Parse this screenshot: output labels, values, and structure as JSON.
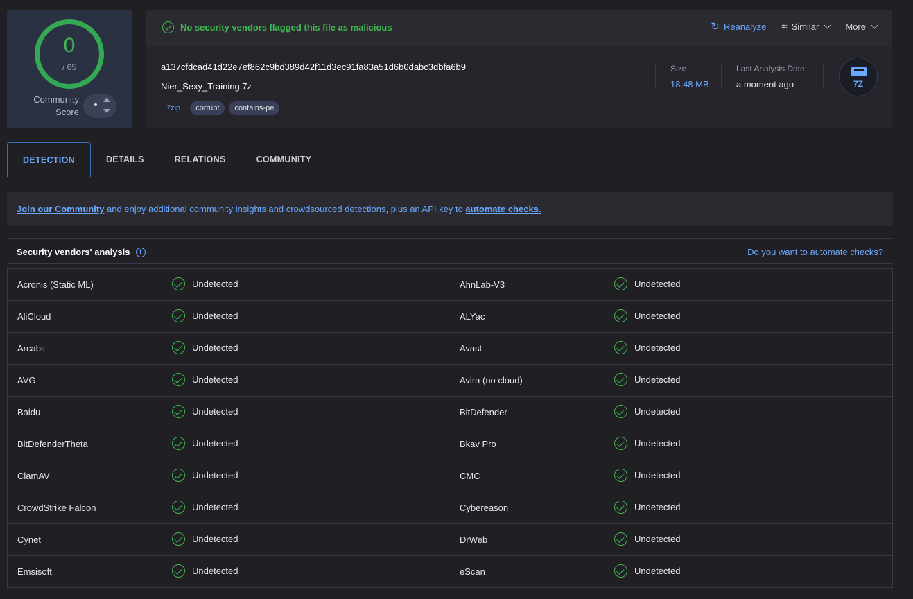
{
  "score": {
    "value": "0",
    "total": "/ 65",
    "community_label_1": "Community",
    "community_label_2": "Score"
  },
  "status": {
    "message": "No security vendors flagged this file as malicious"
  },
  "actions": {
    "reanalyze": "Reanalyze",
    "similar": "Similar",
    "more": "More"
  },
  "file": {
    "hash": "a137cfdcad41d22e7ef862c9bd389d42f11d3ec91fa83a51d6b0dabc3dbfa6b9",
    "name": "Nier_Sexy_Training.7z",
    "tags": [
      "7zip",
      "corrupt",
      "contains-pe"
    ],
    "size_label": "Size",
    "size_value": "18.48 MB",
    "date_label": "Last Analysis Date",
    "date_value": "a moment ago",
    "type_icon_text": "7Z"
  },
  "tabs": [
    "DETECTION",
    "DETAILS",
    "RELATIONS",
    "COMMUNITY"
  ],
  "banner": {
    "link1": "Join our Community",
    "middle": " and enjoy additional community insights and crowdsourced detections, plus an API key to ",
    "link2": "automate checks."
  },
  "section": {
    "title": "Security vendors' analysis",
    "link": "Do you want to automate checks?"
  },
  "colors": {
    "accent": "#6aa8ff",
    "success": "#3fb950",
    "background": "#1f1f24"
  },
  "vendors": [
    [
      "Acronis (Static ML)",
      "Undetected",
      "AhnLab-V3",
      "Undetected"
    ],
    [
      "AliCloud",
      "Undetected",
      "ALYac",
      "Undetected"
    ],
    [
      "Arcabit",
      "Undetected",
      "Avast",
      "Undetected"
    ],
    [
      "AVG",
      "Undetected",
      "Avira (no cloud)",
      "Undetected"
    ],
    [
      "Baidu",
      "Undetected",
      "BitDefender",
      "Undetected"
    ],
    [
      "BitDefenderTheta",
      "Undetected",
      "Bkav Pro",
      "Undetected"
    ],
    [
      "ClamAV",
      "Undetected",
      "CMC",
      "Undetected"
    ],
    [
      "CrowdStrike Falcon",
      "Undetected",
      "Cybereason",
      "Undetected"
    ],
    [
      "Cynet",
      "Undetected",
      "DrWeb",
      "Undetected"
    ],
    [
      "Emsisoft",
      "Undetected",
      "eScan",
      "Undetected"
    ]
  ]
}
